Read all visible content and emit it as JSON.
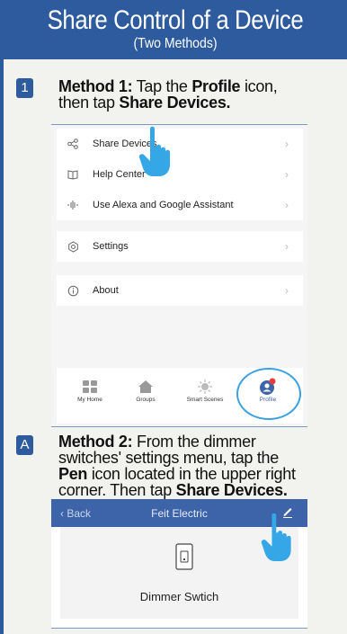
{
  "header": {
    "title": "Share Control of a Device",
    "subtitle": "(Two Methods)"
  },
  "step1": {
    "badge": "1",
    "method_label": "Method 1:",
    "line1_a": " Tap the ",
    "profile_word": "Profile",
    "line1_b": " icon,",
    "line2_a": "then tap ",
    "share_devices": "Share Devices."
  },
  "profile_screen": {
    "menu": [
      {
        "label": "Share Devices",
        "icon": "share-icon"
      },
      {
        "label": "Help Center",
        "icon": "book-icon"
      },
      {
        "label": "Use Alexa and Google Assistant",
        "icon": "voice-icon"
      },
      {
        "label": "Settings",
        "icon": "settings-icon"
      },
      {
        "label": "About",
        "icon": "info-icon"
      }
    ],
    "tabs": [
      {
        "label": "My Home",
        "icon": "grid-icon"
      },
      {
        "label": "Groups",
        "icon": "house-icon"
      },
      {
        "label": "Smart Scenes",
        "icon": "sun-icon"
      },
      {
        "label": "Profile",
        "icon": "profile-icon"
      }
    ],
    "colors": {
      "highlight_ring": "#3aa0e0",
      "profile_red": "#e33d3d",
      "tab_active": "#3d64a8"
    }
  },
  "stepA": {
    "badge": "A",
    "method_label": "Method 2:",
    "line1": " From the dimmer",
    "line2": "switches' settings menu, tap the",
    "pen_word": "Pen",
    "line3": " icon located in the upper right",
    "line4_a": "corner. Then tap ",
    "share_devices": "Share Devices."
  },
  "dimmer_screen": {
    "back": "Back",
    "title": "Feit Electric",
    "device_name": "Dimmer Swtich"
  },
  "colors": {
    "brand_blue": "#2d5b9e",
    "hand": "#35a7e6"
  }
}
